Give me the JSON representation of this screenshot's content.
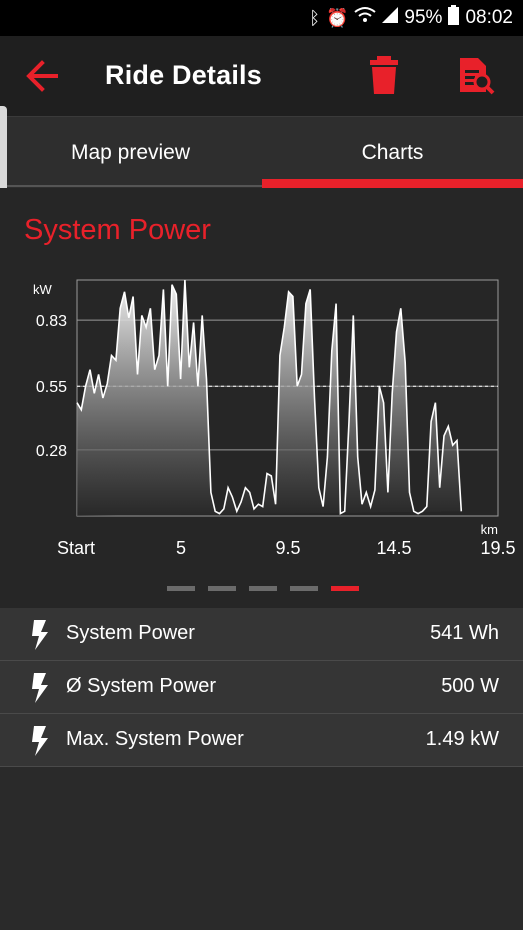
{
  "status_bar": {
    "battery_percent": "95%",
    "time": "08:02"
  },
  "header": {
    "title": "Ride Details"
  },
  "tabs": [
    {
      "label": "Map preview"
    },
    {
      "label": "Charts"
    }
  ],
  "chart_title": "System Power",
  "chart_data": {
    "type": "area",
    "ylabel": "kW",
    "xlabel": "km",
    "y_ticks": [
      "0.28",
      "0.55",
      "0.83"
    ],
    "x_ticks": [
      "Start",
      "5",
      "9.5",
      "14.5",
      "19.5"
    ],
    "ylim": [
      0,
      1.0
    ],
    "xlim": [
      0,
      19.5
    ],
    "average_line": 0.55,
    "x": [
      0.0,
      0.2,
      0.4,
      0.6,
      0.8,
      1.0,
      1.2,
      1.4,
      1.6,
      1.8,
      2.0,
      2.2,
      2.4,
      2.6,
      2.8,
      3.0,
      3.2,
      3.4,
      3.6,
      3.8,
      4.0,
      4.2,
      4.4,
      4.6,
      4.8,
      5.0,
      5.2,
      5.4,
      5.6,
      5.8,
      6.0,
      6.2,
      6.4,
      6.6,
      6.8,
      7.0,
      7.2,
      7.4,
      7.6,
      7.8,
      8.0,
      8.2,
      8.4,
      8.6,
      8.8,
      9.0,
      9.2,
      9.4,
      9.6,
      9.8,
      10.0,
      10.2,
      10.4,
      10.6,
      10.8,
      11.0,
      11.2,
      11.4,
      11.6,
      11.8,
      12.0,
      12.2,
      12.4,
      12.6,
      12.8,
      13.0,
      13.2,
      13.4,
      13.6,
      13.8,
      14.0,
      14.2,
      14.4,
      14.6,
      14.8,
      15.0,
      15.2,
      15.4,
      15.6,
      15.8,
      16.0,
      16.2,
      16.4,
      16.6,
      16.8,
      17.0,
      17.2,
      17.4,
      17.6,
      17.8,
      18.0,
      18.2,
      18.4,
      18.6,
      18.8,
      19.0,
      19.2,
      19.5
    ],
    "values": [
      0.48,
      0.45,
      0.55,
      0.62,
      0.52,
      0.6,
      0.5,
      0.56,
      0.68,
      0.66,
      0.88,
      0.95,
      0.84,
      0.93,
      0.6,
      0.85,
      0.8,
      0.88,
      0.62,
      0.68,
      0.96,
      0.55,
      0.98,
      0.94,
      0.58,
      1.0,
      0.63,
      0.82,
      0.55,
      0.85,
      0.58,
      0.1,
      0.02,
      0.01,
      0.03,
      0.12,
      0.08,
      0.02,
      0.06,
      0.12,
      0.1,
      0.03,
      0.05,
      0.04,
      0.18,
      0.17,
      0.05,
      0.68,
      0.8,
      0.95,
      0.93,
      0.55,
      0.6,
      0.9,
      0.96,
      0.5,
      0.12,
      0.04,
      0.25,
      0.7,
      0.9,
      0.01,
      0.02,
      0.4,
      0.85,
      0.25,
      0.05,
      0.1,
      0.04,
      0.11,
      0.55,
      0.48,
      0.1,
      0.52,
      0.78,
      0.88,
      0.65,
      0.1,
      0.02,
      0.01,
      0.02,
      0.04,
      0.4,
      0.48,
      0.12,
      0.34,
      0.38,
      0.3,
      0.32,
      0.02
    ],
    "color_fill_top": "#ffffff",
    "color_fill_bottom": "#2a2a2a"
  },
  "page_indicator": {
    "count": 5,
    "active_index": 4,
    "active_color": "#e8212a",
    "inactive_color": "#6b6b6b"
  },
  "stats": [
    {
      "label": "System Power",
      "value": "541 Wh"
    },
    {
      "label": "Ø System Power",
      "value": "500 W"
    },
    {
      "label": "Max. System Power",
      "value": "1.49 kW"
    }
  ],
  "colors": {
    "accent": "#e8212a"
  }
}
